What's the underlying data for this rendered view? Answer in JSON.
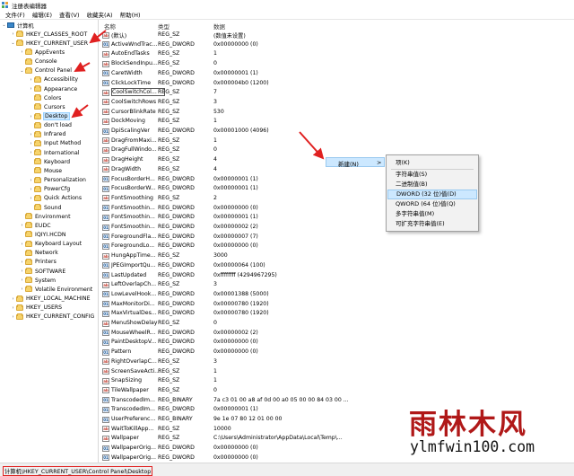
{
  "window": {
    "title": "注册表编辑器"
  },
  "menu": [
    "文件(F)",
    "编辑(E)",
    "查看(V)",
    "收藏夹(A)",
    "帮助(H)"
  ],
  "tree": [
    {
      "label": "计算机",
      "depth": 0,
      "expander": "⌄",
      "icon": "computer-icon"
    },
    {
      "label": "HKEY_CLASSES_ROOT",
      "depth": 1,
      "expander": "›"
    },
    {
      "label": "HKEY_CURRENT_USER",
      "depth": 1,
      "expander": "⌄"
    },
    {
      "label": "AppEvents",
      "depth": 2,
      "expander": "›"
    },
    {
      "label": "Console",
      "depth": 2,
      "expander": ""
    },
    {
      "label": "Control Panel",
      "depth": 2,
      "expander": "⌄"
    },
    {
      "label": "Accessibility",
      "depth": 3,
      "expander": "›"
    },
    {
      "label": "Appearance",
      "depth": 3,
      "expander": "›"
    },
    {
      "label": "Colors",
      "depth": 3,
      "expander": ""
    },
    {
      "label": "Cursors",
      "depth": 3,
      "expander": ""
    },
    {
      "label": "Desktop",
      "depth": 3,
      "expander": "›",
      "selected": true
    },
    {
      "label": "don't load",
      "depth": 3,
      "expander": ""
    },
    {
      "label": "Infrared",
      "depth": 3,
      "expander": "›"
    },
    {
      "label": "Input Method",
      "depth": 3,
      "expander": "›"
    },
    {
      "label": "International",
      "depth": 3,
      "expander": "›"
    },
    {
      "label": "Keyboard",
      "depth": 3,
      "expander": ""
    },
    {
      "label": "Mouse",
      "depth": 3,
      "expander": ""
    },
    {
      "label": "Personalization",
      "depth": 3,
      "expander": "›"
    },
    {
      "label": "PowerCfg",
      "depth": 3,
      "expander": "›"
    },
    {
      "label": "Quick Actions",
      "depth": 3,
      "expander": "›"
    },
    {
      "label": "Sound",
      "depth": 3,
      "expander": ""
    },
    {
      "label": "Environment",
      "depth": 2,
      "expander": ""
    },
    {
      "label": "EUDC",
      "depth": 2,
      "expander": "›"
    },
    {
      "label": "IQIYI.HCDN",
      "depth": 2,
      "expander": ""
    },
    {
      "label": "Keyboard Layout",
      "depth": 2,
      "expander": "›"
    },
    {
      "label": "Network",
      "depth": 2,
      "expander": ""
    },
    {
      "label": "Printers",
      "depth": 2,
      "expander": "›"
    },
    {
      "label": "SOFTWARE",
      "depth": 2,
      "expander": "›"
    },
    {
      "label": "System",
      "depth": 2,
      "expander": "›"
    },
    {
      "label": "Volatile Environment",
      "depth": 2,
      "expander": "›"
    },
    {
      "label": "HKEY_LOCAL_MACHINE",
      "depth": 1,
      "expander": "›"
    },
    {
      "label": "HKEY_USERS",
      "depth": 1,
      "expander": "›"
    },
    {
      "label": "HKEY_CURRENT_CONFIG",
      "depth": 1,
      "expander": "›"
    }
  ],
  "columns": {
    "name": "名称",
    "type": "类型",
    "data": "数据"
  },
  "values": [
    {
      "name": "(默认)",
      "type": "REG_SZ",
      "data": "(数值未设置)",
      "kind": "sz"
    },
    {
      "name": "ActiveWndTrac...",
      "type": "REG_DWORD",
      "data": "0x00000000 (0)",
      "kind": "bin"
    },
    {
      "name": "AutoEndTasks",
      "type": "REG_SZ",
      "data": "1",
      "kind": "sz"
    },
    {
      "name": "BlockSendInpu...",
      "type": "REG_SZ",
      "data": "0",
      "kind": "sz"
    },
    {
      "name": "CaretWidth",
      "type": "REG_DWORD",
      "data": "0x00000001 (1)",
      "kind": "bin"
    },
    {
      "name": "ClickLockTime",
      "type": "REG_DWORD",
      "data": "0x000004b0 (1200)",
      "kind": "bin"
    },
    {
      "name": "CoolSwitchCol...",
      "type": "REG_SZ",
      "data": "7",
      "kind": "sz",
      "focused": true
    },
    {
      "name": "CoolSwitchRows",
      "type": "REG_SZ",
      "data": "3",
      "kind": "sz"
    },
    {
      "name": "CursorBlinkRate",
      "type": "REG_SZ",
      "data": "530",
      "kind": "sz"
    },
    {
      "name": "DockMoving",
      "type": "REG_SZ",
      "data": "1",
      "kind": "sz"
    },
    {
      "name": "DpiScalingVer",
      "type": "REG_DWORD",
      "data": "0x00001000 (4096)",
      "kind": "bin"
    },
    {
      "name": "DragFromMaxi...",
      "type": "REG_SZ",
      "data": "1",
      "kind": "sz"
    },
    {
      "name": "DragFullWindo...",
      "type": "REG_SZ",
      "data": "0",
      "kind": "sz"
    },
    {
      "name": "DragHeight",
      "type": "REG_SZ",
      "data": "4",
      "kind": "sz"
    },
    {
      "name": "DragWidth",
      "type": "REG_SZ",
      "data": "4",
      "kind": "sz"
    },
    {
      "name": "FocusBorderH...",
      "type": "REG_DWORD",
      "data": "0x00000001 (1)",
      "kind": "bin"
    },
    {
      "name": "FocusBorderW...",
      "type": "REG_DWORD",
      "data": "0x00000001 (1)",
      "kind": "bin"
    },
    {
      "name": "FontSmoothing",
      "type": "REG_SZ",
      "data": "2",
      "kind": "sz"
    },
    {
      "name": "FontSmoothin...",
      "type": "REG_DWORD",
      "data": "0x00000000 (0)",
      "kind": "bin"
    },
    {
      "name": "FontSmoothin...",
      "type": "REG_DWORD",
      "data": "0x00000001 (1)",
      "kind": "bin"
    },
    {
      "name": "FontSmoothin...",
      "type": "REG_DWORD",
      "data": "0x00000002 (2)",
      "kind": "bin"
    },
    {
      "name": "ForegroundFla...",
      "type": "REG_DWORD",
      "data": "0x00000007 (7)",
      "kind": "bin"
    },
    {
      "name": "ForegroundLo...",
      "type": "REG_DWORD",
      "data": "0x00000000 (0)",
      "kind": "bin"
    },
    {
      "name": "HungAppTime...",
      "type": "REG_SZ",
      "data": "3000",
      "kind": "sz"
    },
    {
      "name": "JPEGImportQu...",
      "type": "REG_DWORD",
      "data": "0x00000064 (100)",
      "kind": "bin"
    },
    {
      "name": "LastUpdated",
      "type": "REG_DWORD",
      "data": "0xffffffff (4294967295)",
      "kind": "bin"
    },
    {
      "name": "LeftOverlapCh...",
      "type": "REG_SZ",
      "data": "3",
      "kind": "sz"
    },
    {
      "name": "LowLevelHook...",
      "type": "REG_DWORD",
      "data": "0x00001388 (5000)",
      "kind": "bin"
    },
    {
      "name": "MaxMonitorDi...",
      "type": "REG_DWORD",
      "data": "0x00000780 (1920)",
      "kind": "bin"
    },
    {
      "name": "MaxVirtualDes...",
      "type": "REG_DWORD",
      "data": "0x00000780 (1920)",
      "kind": "bin"
    },
    {
      "name": "MenuShowDelay",
      "type": "REG_SZ",
      "data": "0",
      "kind": "sz"
    },
    {
      "name": "MouseWheelR...",
      "type": "REG_DWORD",
      "data": "0x00000002 (2)",
      "kind": "bin"
    },
    {
      "name": "PaintDesktopV...",
      "type": "REG_DWORD",
      "data": "0x00000000 (0)",
      "kind": "bin"
    },
    {
      "name": "Pattern",
      "type": "REG_DWORD",
      "data": "0x00000000 (0)",
      "kind": "bin"
    },
    {
      "name": "RightOverlapC...",
      "type": "REG_SZ",
      "data": "3",
      "kind": "sz"
    },
    {
      "name": "ScreenSaveActi...",
      "type": "REG_SZ",
      "data": "1",
      "kind": "sz"
    },
    {
      "name": "SnapSizing",
      "type": "REG_SZ",
      "data": "1",
      "kind": "sz"
    },
    {
      "name": "TileWallpaper",
      "type": "REG_SZ",
      "data": "0",
      "kind": "sz"
    },
    {
      "name": "TranscodedIm...",
      "type": "REG_BINARY",
      "data": "7a c3 01 00 a8 af 0d 00 a0 05 00 00 84 03 00 ...",
      "kind": "bin"
    },
    {
      "name": "TranscodedIm...",
      "type": "REG_DWORD",
      "data": "0x00000001 (1)",
      "kind": "bin"
    },
    {
      "name": "UserPreferenc...",
      "type": "REG_BINARY",
      "data": "9e 1e 07 80 12 01 00 00",
      "kind": "bin"
    },
    {
      "name": "WaitToKillApp...",
      "type": "REG_SZ",
      "data": "10000",
      "kind": "sz"
    },
    {
      "name": "Wallpaper",
      "type": "REG_SZ",
      "data": "C:\\Users\\Administrator\\AppData\\Local\\Temp\\...",
      "kind": "sz"
    },
    {
      "name": "WallpaperOrig...",
      "type": "REG_DWORD",
      "data": "0x00000000 (0)",
      "kind": "bin"
    },
    {
      "name": "WallpaperOrig...",
      "type": "REG_DWORD",
      "data": "0x00000000 (0)",
      "kind": "bin"
    }
  ],
  "context_menu": {
    "new_label": "新建(N)",
    "new_arrow": ">",
    "submenu": [
      {
        "label": "项(K)",
        "sep_after": true
      },
      {
        "label": "字符串值(S)"
      },
      {
        "label": "二进制值(B)"
      },
      {
        "label": "DWORD (32 位)值(D)",
        "highlighted": true
      },
      {
        "label": "QWORD (64 位)值(Q)"
      },
      {
        "label": "多字符串值(M)"
      },
      {
        "label": "可扩充字符串值(E)"
      }
    ]
  },
  "status": {
    "path": "计算机\\HKEY_CURRENT_USER\\Control Panel\\Desktop"
  },
  "watermark": {
    "cn": "雨林木风",
    "en": "ylmfwin100.com"
  },
  "colors": {
    "annotation": "#e02020",
    "selection": "#cce8ff",
    "watermark_cn": "#b01818"
  }
}
